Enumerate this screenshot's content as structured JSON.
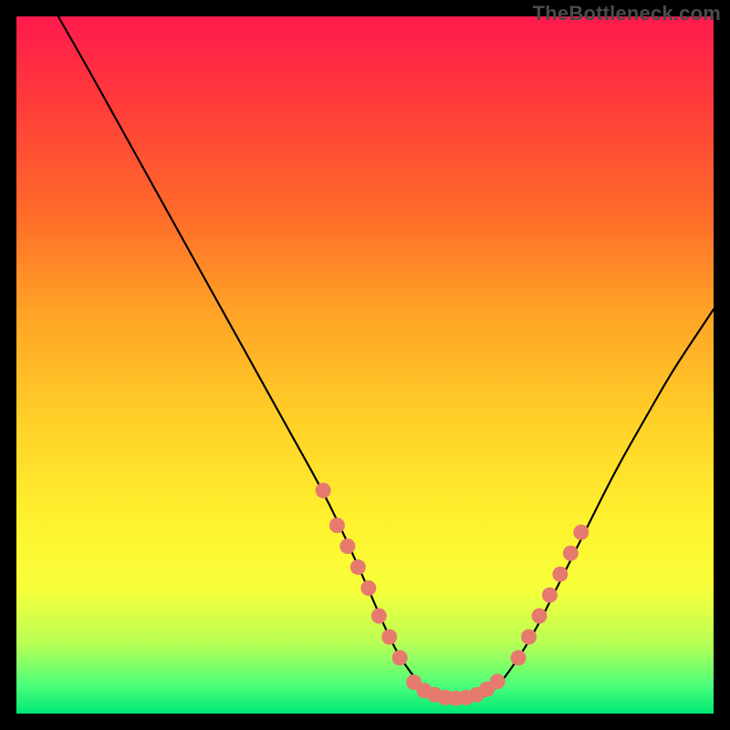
{
  "watermark": "TheBottleneck.com",
  "chart_data": {
    "type": "line",
    "title": "",
    "xlabel": "",
    "ylabel": "",
    "xlim": [
      0,
      100
    ],
    "ylim": [
      0,
      100
    ],
    "series": [
      {
        "name": "curve",
        "color": "#000000",
        "x": [
          6,
          10,
          15,
          20,
          25,
          30,
          35,
          40,
          45,
          50,
          53,
          55,
          58,
          60,
          62,
          64,
          66,
          68,
          70,
          74,
          78,
          82,
          86,
          90,
          94,
          98,
          100
        ],
        "y": [
          100,
          93,
          84,
          75,
          66,
          57,
          48,
          39,
          30,
          19,
          12,
          8,
          4,
          2.5,
          2,
          2,
          2,
          3,
          5,
          11,
          19,
          27,
          35,
          42,
          49,
          55,
          58
        ]
      }
    ],
    "highlight_segments": [
      {
        "name": "left-dots",
        "color": "#e77a6e",
        "points_xy": [
          [
            44,
            32
          ],
          [
            46,
            27
          ],
          [
            47.5,
            24
          ],
          [
            49,
            21
          ],
          [
            50.5,
            18
          ],
          [
            52,
            14
          ],
          [
            53.5,
            11
          ],
          [
            55,
            8
          ]
        ]
      },
      {
        "name": "bottom-dots",
        "color": "#e77a6e",
        "points_xy": [
          [
            57,
            4.5
          ],
          [
            58.5,
            3.3
          ],
          [
            60,
            2.7
          ],
          [
            61.5,
            2.3
          ],
          [
            63,
            2.2
          ],
          [
            64.5,
            2.3
          ],
          [
            66,
            2.7
          ],
          [
            67.5,
            3.5
          ],
          [
            69,
            4.6
          ]
        ]
      },
      {
        "name": "right-dots",
        "color": "#e77a6e",
        "points_xy": [
          [
            72,
            8
          ],
          [
            73.5,
            11
          ],
          [
            75,
            14
          ],
          [
            76.5,
            17
          ],
          [
            78,
            20
          ],
          [
            79.5,
            23
          ],
          [
            81,
            26
          ]
        ]
      }
    ]
  }
}
